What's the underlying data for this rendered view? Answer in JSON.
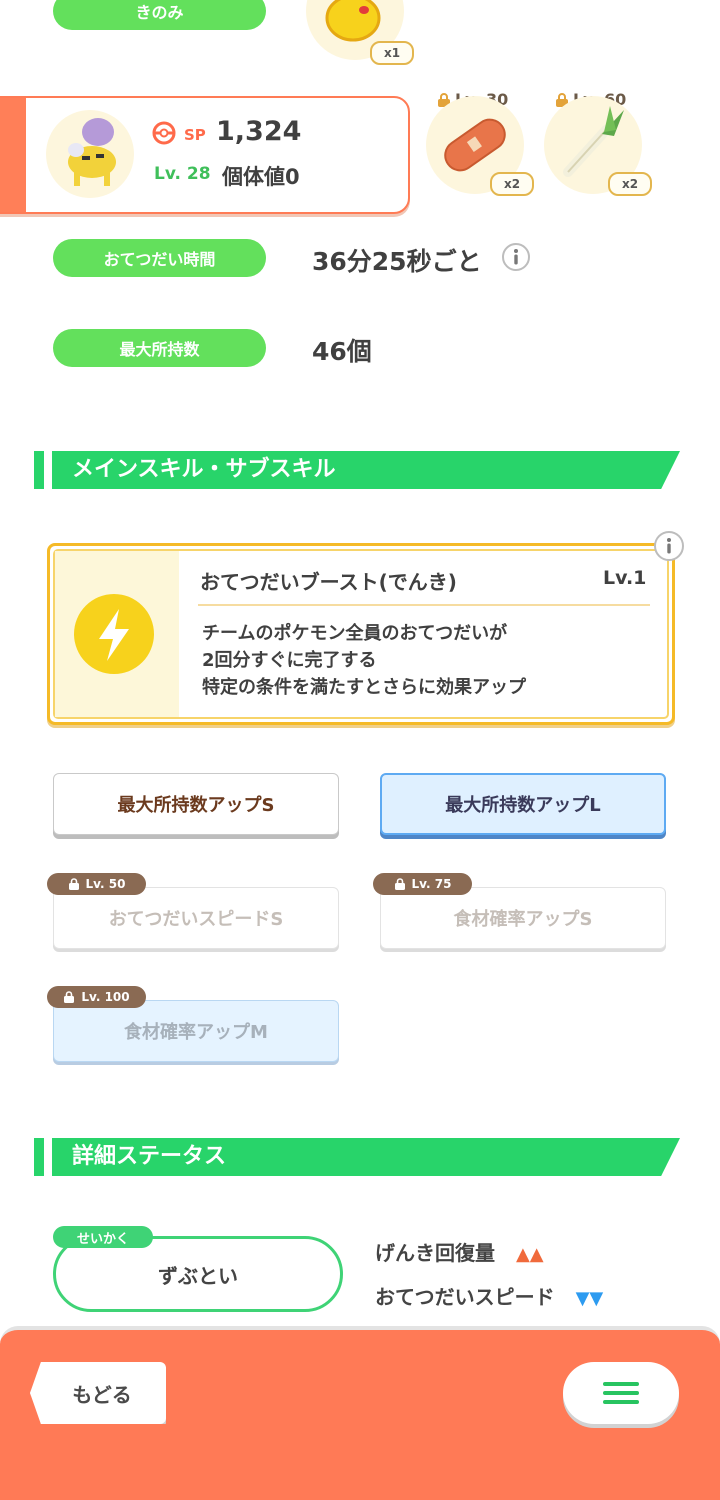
{
  "ingredients": {
    "label": "きのみ",
    "items": [
      {
        "name": "berry",
        "qty": "x1",
        "level": ""
      },
      {
        "name": "sausage",
        "qty": "x2",
        "level": "Lv. 30"
      },
      {
        "name": "leek",
        "qty": "x2",
        "level": "Lv. 60"
      }
    ]
  },
  "pokemon": {
    "sp_label": "SP",
    "sp_value": "1,324",
    "level": "Lv. 28",
    "iv": "個体値0"
  },
  "stats": {
    "help_time_label": "おてつだい時間",
    "help_time_value": "36分25秒ごと",
    "max_carry_label": "最大所持数",
    "max_carry_value": "46個"
  },
  "skills_section": {
    "title": "メインスキル・サブスキル",
    "main_skill": {
      "name": "おてつだいブースト(でんき)",
      "level": "Lv.1",
      "description": [
        "チームのポケモン全員のおてつだいが",
        "2回分すぐに完了する",
        "特定の条件を満たすとさらに効果アップ"
      ]
    },
    "sub_skills": [
      {
        "label": "最大所持数アップS",
        "lock": ""
      },
      {
        "label": "最大所持数アップL",
        "lock": ""
      },
      {
        "label": "おてつだいスピードS",
        "lock": "Lv. 50"
      },
      {
        "label": "食材確率アップS",
        "lock": "Lv. 75"
      },
      {
        "label": "食材確率アップM",
        "lock": "Lv. 100"
      }
    ]
  },
  "details_section": {
    "title": "詳細ステータス",
    "nature_tag": "せいかく",
    "nature": "ずぶとい",
    "effects": [
      {
        "label": "げんき回復量",
        "arrows": "▲▲",
        "color": "#f06a3c"
      },
      {
        "label": "おてつだいスピード",
        "arrows": "▼▼",
        "color": "#2d9bf0"
      }
    ]
  },
  "nav": {
    "back_label": "もどる"
  },
  "colors": {
    "accent_green": "#28d46a",
    "pill_green": "#63e05c",
    "orange": "#ff7a56",
    "gold": "#f5ba27"
  }
}
